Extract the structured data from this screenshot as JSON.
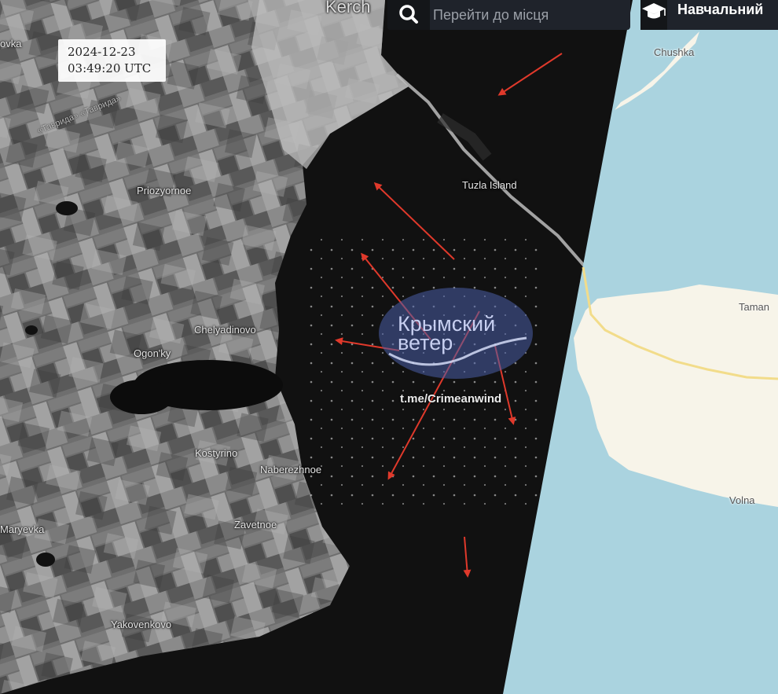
{
  "timestamp": {
    "date": "2024-12-23",
    "time": "03:49:20 UTC"
  },
  "search": {
    "placeholder": "Перейти до місця",
    "icon": "search-icon"
  },
  "mode_button": {
    "label": "Навчальний",
    "icon": "graduation-cap-icon"
  },
  "watermark": {
    "name_line1": "Крымский",
    "name_line2": "ветер",
    "link": "t.me/Crimeanwind"
  },
  "places": {
    "kerch": "Kerch",
    "ovka": "ovka",
    "priozyornoe": "Priozyornoe",
    "chelyadinovo": "Chelyadinovo",
    "ogonky": "Ogon'ky",
    "kostyrino": "Kostyrino",
    "naberezhnoe": "Naberezhnoe",
    "zavetnoe": "Zavetnoe",
    "maryevka": "Maryevka",
    "yakovenkovo": "Yakovenkovo",
    "tuzla": "Tuzla Island",
    "chushka": "Chushka",
    "taman": "Taman",
    "volna": "Volna"
  },
  "roads": {
    "tavrida": "«Таврида» «Таврида»"
  },
  "colors": {
    "sea": "#aad3df",
    "land": "#f7f4e9",
    "satellite_dark": "#111111",
    "arrow": "#e0392b",
    "road": "#f2dc8a"
  }
}
